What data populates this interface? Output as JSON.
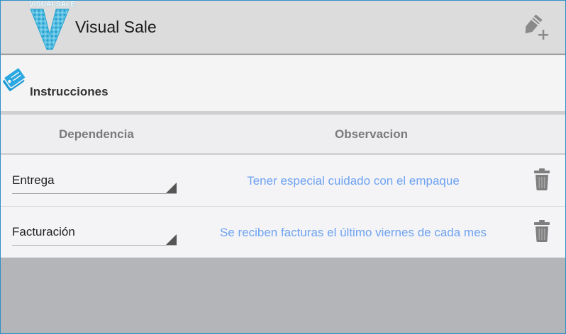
{
  "app": {
    "title": "Visual Sale",
    "logo_text": "VISUALSALE",
    "brand_color": "#2aa8d4"
  },
  "section": {
    "title": "Instrucciones",
    "icon": "tags-icon"
  },
  "table": {
    "headers": [
      "Dependencia",
      "Observacion"
    ],
    "rows": [
      {
        "dependencia": "Entrega",
        "observacion": "Tener especial cuidado con el empaque"
      },
      {
        "dependencia": "Facturación",
        "observacion": "Se reciben facturas el último viernes de cada mes"
      }
    ]
  },
  "icons": {
    "add_note": "add-note-icon",
    "delete": "trash-icon"
  }
}
